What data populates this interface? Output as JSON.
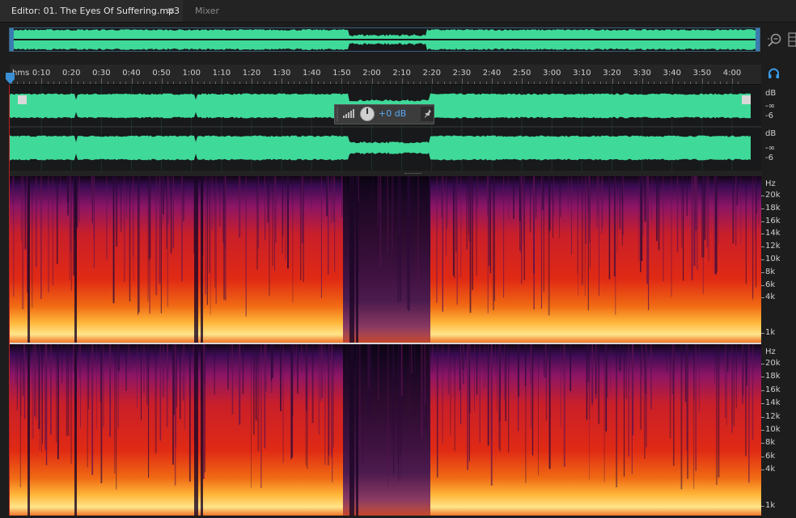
{
  "tabs": {
    "editor_label": "Editor: 01. The Eyes Of Suffering.mp3",
    "menu_glyph": "≡",
    "mixer_label": "Mixer"
  },
  "ruler": {
    "unit_label": "hms",
    "ticks": [
      "0:10",
      "0:20",
      "0:30",
      "0:40",
      "0:50",
      "1:00",
      "1:10",
      "1:20",
      "1:30",
      "1:40",
      "1:50",
      "2:00",
      "2:10",
      "2:20",
      "2:30",
      "2:40",
      "2:50",
      "3:00",
      "3:10",
      "3:20",
      "3:30",
      "3:40",
      "3:50",
      "4:00"
    ]
  },
  "amplitude_scale": {
    "unit": "dB",
    "labels": [
      "-∞",
      "-6"
    ]
  },
  "frequency_scale": {
    "unit": "Hz",
    "labels": [
      "20k",
      "18k",
      "16k",
      "14k",
      "12k",
      "10k",
      "8k",
      "6k",
      "4k",
      "1k"
    ]
  },
  "hud": {
    "gain_label": "+0 dB"
  },
  "icons": {
    "zoom": "zoom-icon",
    "panel": "panel-icon",
    "headphones": "headphone-icon",
    "knob": "volume-knob-icon",
    "pin": "pin-icon",
    "meter": "level-meter-icon"
  },
  "colors": {
    "waveform": "#3fd99a",
    "accent": "#3a8fd6",
    "spectrum_low": "#2a0b3d",
    "spectrum_mid": "#d61e1e",
    "spectrum_high": "#ffd45a",
    "gain_text": "#5aa9f2"
  }
}
